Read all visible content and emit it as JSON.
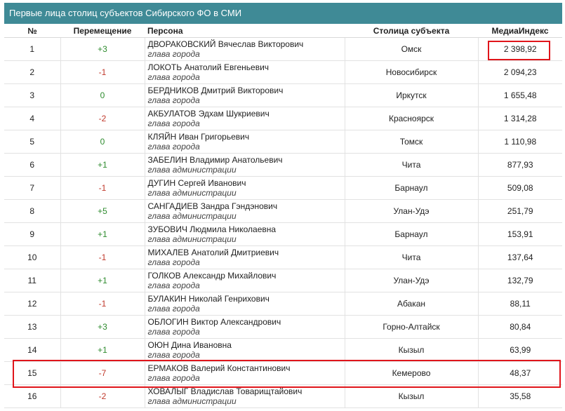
{
  "title": "Первые лица столиц субъектов Сибирского ФО в СМИ",
  "columns": {
    "num": "№",
    "move": "Перемещение",
    "person": "Персона",
    "city": "Столица субъекта",
    "index": "МедиаИндекс"
  },
  "rows": [
    {
      "num": "1",
      "move": "+3",
      "name": "ДВОРАКОВСКИЙ Вячеслав Викторович",
      "role": "глава города",
      "city": "Омск",
      "index": "2 398,92"
    },
    {
      "num": "2",
      "move": "-1",
      "name": "ЛОКОТЬ Анатолий Евгеньевич",
      "role": "глава города",
      "city": "Новосибирск",
      "index": "2 094,23"
    },
    {
      "num": "3",
      "move": "0",
      "name": "БЕРДНИКОВ Дмитрий Викторович",
      "role": "глава города",
      "city": "Иркутск",
      "index": "1 655,48"
    },
    {
      "num": "4",
      "move": "-2",
      "name": "АКБУЛАТОВ Эдхам Шукриевич",
      "role": "глава города",
      "city": "Красноярск",
      "index": "1 314,28"
    },
    {
      "num": "5",
      "move": "0",
      "name": "КЛЯЙН Иван Григорьевич",
      "role": "глава города",
      "city": "Томск",
      "index": "1 110,98"
    },
    {
      "num": "6",
      "move": "+1",
      "name": "ЗАБЕЛИН Владимир Анатольевич",
      "role": "глава администрации",
      "city": "Чита",
      "index": "877,93"
    },
    {
      "num": "7",
      "move": "-1",
      "name": "ДУГИН Сергей Иванович",
      "role": "глава администрации",
      "city": "Барнаул",
      "index": "509,08"
    },
    {
      "num": "8",
      "move": "+5",
      "name": "САНГАДИЕВ Зандра Гэндэнович",
      "role": "глава администрации",
      "city": "Улан-Удэ",
      "index": "251,79"
    },
    {
      "num": "9",
      "move": "+1",
      "name": "ЗУБОВИЧ Людмила Николаевна",
      "role": "глава администрации",
      "city": "Барнаул",
      "index": "153,91"
    },
    {
      "num": "10",
      "move": "-1",
      "name": "МИХАЛЕВ Анатолий Дмитриевич",
      "role": "глава города",
      "city": "Чита",
      "index": "137,64"
    },
    {
      "num": "11",
      "move": "+1",
      "name": "ГОЛКОВ Александр Михайлович",
      "role": "глава города",
      "city": "Улан-Удэ",
      "index": "132,79"
    },
    {
      "num": "12",
      "move": "-1",
      "name": "БУЛАКИН Николай Генрихович",
      "role": "глава города",
      "city": "Абакан",
      "index": "88,11"
    },
    {
      "num": "13",
      "move": "+3",
      "name": "ОБЛОГИН Виктор Александрович",
      "role": "глава города",
      "city": "Горно-Алтайск",
      "index": "80,84"
    },
    {
      "num": "14",
      "move": "+1",
      "name": "ОЮН Дина Ивановна",
      "role": "глава города",
      "city": "Кызыл",
      "index": "63,99"
    },
    {
      "num": "15",
      "move": "-7",
      "name": "ЕРМАКОВ Валерий Константинович",
      "role": "глава города",
      "city": "Кемерово",
      "index": "48,37"
    },
    {
      "num": "16",
      "move": "-2",
      "name": "ХОВАЛЫГ Владислав Товарищтайович",
      "role": "глава администрации",
      "city": "Кызыл",
      "index": "35,58"
    }
  ],
  "colors": {
    "header_bg": "#3f8a96",
    "positive": "#2e8b2e",
    "negative": "#c0392b",
    "highlight": "#e0151b"
  }
}
